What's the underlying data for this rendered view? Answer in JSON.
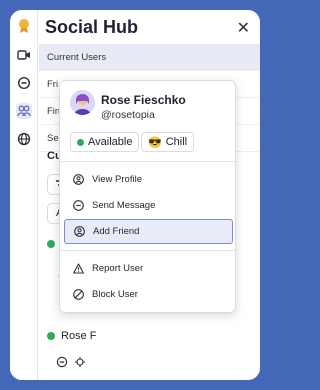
{
  "app": {
    "title": "Social Hub"
  },
  "nav": {
    "items": [
      {
        "label": "Current Users"
      },
      {
        "label": "Fri"
      },
      {
        "label": "Fin"
      },
      {
        "label": "Ser"
      }
    ]
  },
  "section": {
    "label": "Cur"
  },
  "controls": {
    "sort_letter": "A"
  },
  "users": [
    {
      "name": "Rose F",
      "status_color": "#2eaa5c"
    }
  ],
  "profile_card": {
    "name": "Rose Fieschko",
    "handle": "@rosetopia",
    "status": "Available",
    "mood_emoji": "😎",
    "mood": "Chill",
    "menu": [
      {
        "label": "View Profile",
        "icon": "user-circle-icon"
      },
      {
        "label": "Send Message",
        "icon": "chat-bubble-icon"
      },
      {
        "label": "Add Friend",
        "icon": "add-user-icon",
        "highlighted": true
      },
      {
        "label": "Report User",
        "icon": "warning-icon"
      },
      {
        "label": "Block User",
        "icon": "block-icon"
      }
    ]
  },
  "colors": {
    "frame": "#4467b8",
    "accent": "#7b8fd6",
    "online": "#2eaa5c"
  }
}
